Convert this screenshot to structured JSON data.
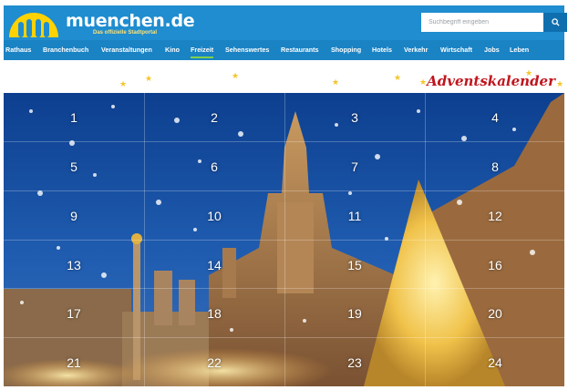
{
  "header": {
    "logo_text": "muenchen.de",
    "logo_subtitle": "Das offizielle Stadtportal",
    "search_placeholder": "Suchbegriff eingeben",
    "search_icon": "search-icon",
    "colors": {
      "header": "#1f8dcf",
      "nav": "#1a83c4",
      "logo_yellow": "#ffd200"
    }
  },
  "nav": {
    "items": [
      {
        "label": "Rathaus"
      },
      {
        "label": "Branchenbuch"
      },
      {
        "label": "Veranstaltungen"
      },
      {
        "label": "Kino"
      },
      {
        "label": "Freizeit"
      },
      {
        "label": "Sehenswertes"
      },
      {
        "label": "Restaurants"
      },
      {
        "label": "Shopping"
      },
      {
        "label": "Hotels"
      },
      {
        "label": "Verkehr"
      },
      {
        "label": "Wirtschaft"
      },
      {
        "label": "Jobs"
      },
      {
        "label": "Leben"
      }
    ],
    "active": "Freizeit"
  },
  "banner": {
    "title": "Adventskalender",
    "title_color": "#c0161e"
  },
  "calendar": {
    "doors": [
      "1",
      "2",
      "3",
      "4",
      "5",
      "6",
      "7",
      "8",
      "9",
      "10",
      "11",
      "12",
      "13",
      "14",
      "15",
      "16",
      "17",
      "18",
      "19",
      "20",
      "21",
      "22",
      "23",
      "24"
    ]
  }
}
